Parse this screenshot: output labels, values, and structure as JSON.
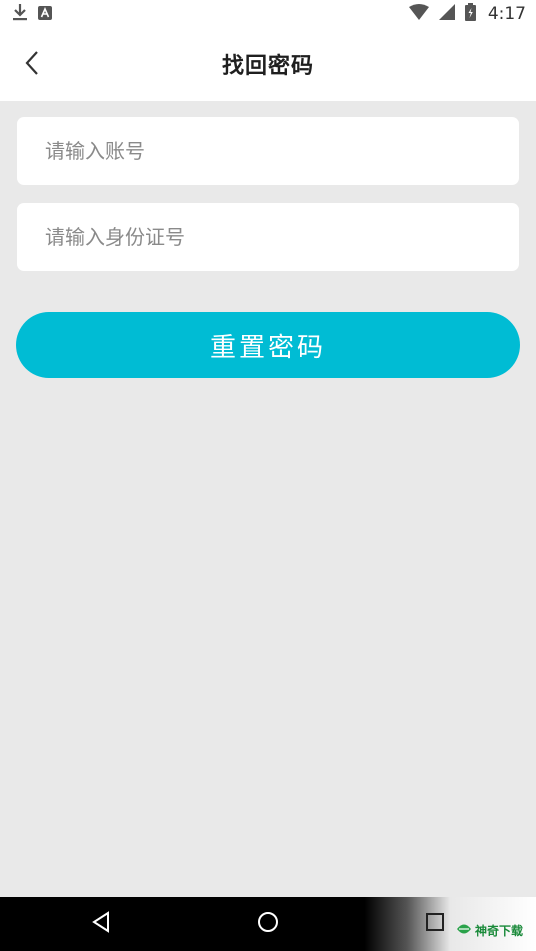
{
  "status_bar": {
    "time": "4:17",
    "icons": [
      "download-icon",
      "a-icon",
      "wifi-icon",
      "signal-icon",
      "battery-icon"
    ]
  },
  "header": {
    "title": "找回密码",
    "back_icon": "chevron-left-icon"
  },
  "form": {
    "account_placeholder": "请输入账号",
    "account_value": "",
    "id_placeholder": "请输入身份证号",
    "id_value": ""
  },
  "actions": {
    "reset_label": "重置密码"
  },
  "nav_bar": {
    "icons": [
      "back-triangle-icon",
      "home-circle-icon",
      "recents-square-icon"
    ]
  },
  "watermark": {
    "text": "神奇下载"
  },
  "colors": {
    "accent": "#00bcd4",
    "background": "#e9e9e9",
    "field_bg": "#ffffff"
  }
}
